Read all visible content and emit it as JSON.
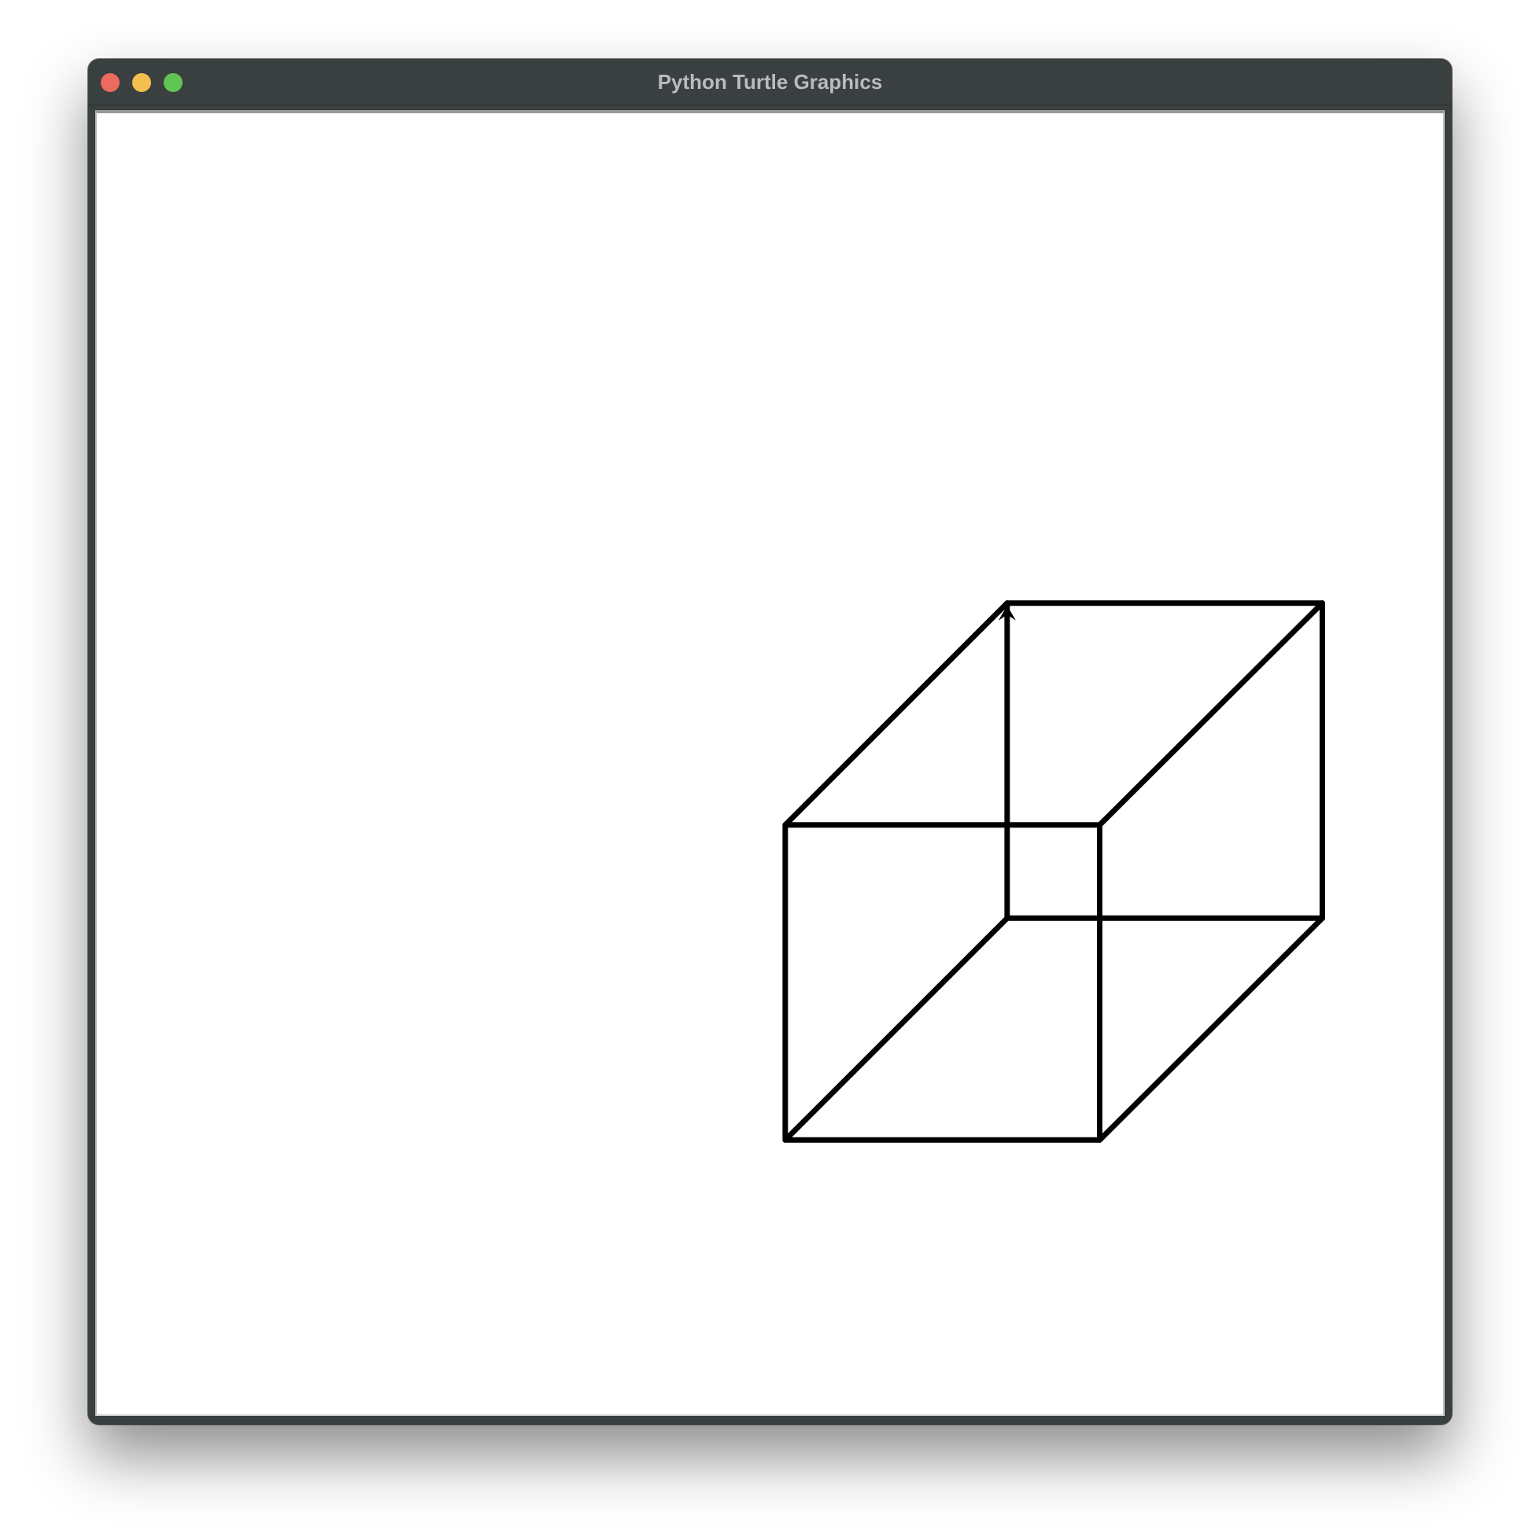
{
  "window": {
    "title": "Python Turtle Graphics"
  },
  "colors": {
    "close": "#ed6a5e",
    "minimize": "#f4bf4f",
    "zoom": "#61c554",
    "stroke": "#000000",
    "canvas": "#ffffff"
  },
  "drawing": {
    "shape": "cube-wireframe",
    "turtle_cursor": "arrow-icon",
    "turtle_heading": "up"
  }
}
